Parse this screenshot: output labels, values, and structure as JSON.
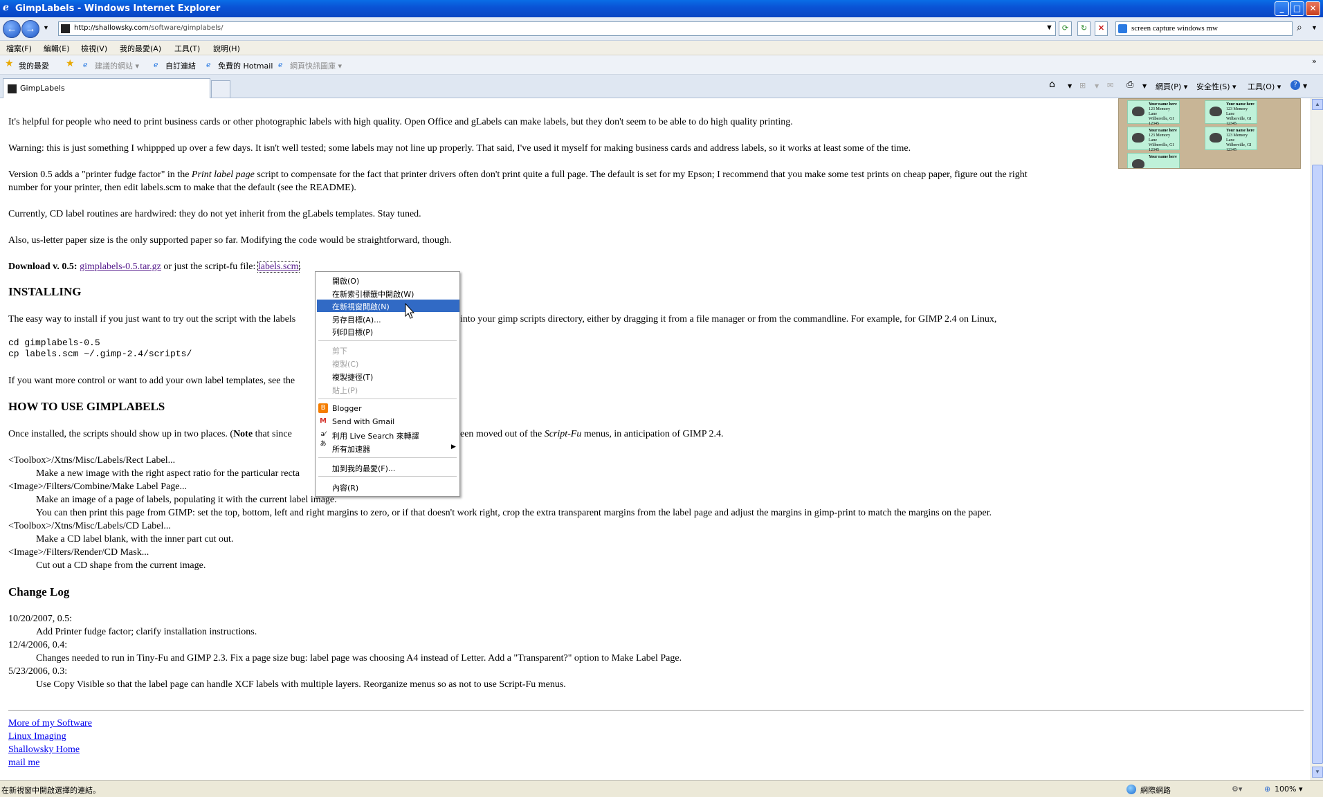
{
  "window": {
    "title": "GimpLabels - Windows Internet Explorer",
    "controls": {
      "minimize": "_",
      "maximize": "□",
      "close": "✕"
    }
  },
  "addressbar": {
    "url_domain": "http://shallowsky.com",
    "url_path": "/software/gimplabels/",
    "search_value": "screen capture windows mw"
  },
  "menubar": [
    "檔案(F)",
    "編輯(E)",
    "檢視(V)",
    "我的最愛(A)",
    "工具(T)",
    "說明(H)"
  ],
  "favbar": {
    "favorites": "我的最愛",
    "suggested": "建議的網站 ▾",
    "custom_links": "自訂連結",
    "hotmail": "免費的 Hotmail",
    "webslice": "網頁快訊圖庫 ▾",
    "more": "»"
  },
  "tabs": [
    {
      "label": "GimpLabels"
    }
  ],
  "commandbar": {
    "page": "網頁(P) ▾",
    "safety": "安全性(S) ▾",
    "tools": "工具(O) ▾"
  },
  "content": {
    "p1": "It's helpful for people who need to print business cards or other photographic labels with high quality. Open Office and gLabels can make labels, but they don't seem to be able to do high quality printing.",
    "p2": "Warning: this is just something I whippped up over a few days. It isn't well tested; some labels may not line up properly. That said, I've used it myself for making business cards and address labels, so it works at least some of the time.",
    "p3_a": "Version 0.5 adds a \"printer fudge factor\" in the ",
    "p3_em": "Print label page",
    "p3_b": " script to compensate for the fact that printer drivers often don't print quite a full page. The default is set for my Epson; I recommend that you make some test prints on cheap paper, figure out the right",
    "p3_c": "number for your printer, then edit labels.scm to make that the default (see the README).",
    "p4": "Currently, CD label routines are hardwired: they do not yet inherit from the gLabels templates. Stay tuned.",
    "p5": "Also, us-letter paper size is the only supported paper so far. Modifying the code would be straightforward, though.",
    "download_label": "Download v. 0.5:",
    "download_link1": "gimplabels-0.5.tar.gz",
    "download_mid": " or just the script-fu file: ",
    "download_link2": "labels.scm",
    "download_end": ".",
    "h_install": "INSTALLING",
    "install_a": "The easy way to install if you just want to try out the script with the labels ",
    "install_b": "into your gimp scripts directory, either by dragging it from a file manager or from the commandline. For example, for GIMP 2.4 on Linux,",
    "code": "cd gimplabels-0.5\ncp labels.scm ~/.gimp-2.4/scripts/",
    "more_control": "If you want more control or want to add your own label templates, see the",
    "h_howto": "HOW TO USE GIMPLABELS",
    "howto_a": "Once installed, the scripts should show up in two places. (",
    "howto_note": "Note",
    "howto_b": " that since",
    "howto_c": "een moved out of the ",
    "howto_em": "Script-Fu",
    "howto_d": " menus, in anticipation of GIMP 2.4.",
    "dl": [
      {
        "term": "<Toolbox>/Xtns/Misc/Labels/Rect Label...",
        "desc": [
          "Make a new image with the right aspect ratio for the particular recta"
        ]
      },
      {
        "term": "<Image>/Filters/Combine/Make Label Page...",
        "desc": [
          "Make an image of a page of labels, populating it with the current label image.",
          "You can then print this page from GIMP: set the top, bottom, left and right margins to zero, or if that doesn't work right, crop the extra transparent margins from the label page and adjust the margins in gimp-print to match the margins on the paper."
        ]
      },
      {
        "term": "<Toolbox>/Xtns/Misc/Labels/CD Label...",
        "desc": [
          "Make a CD label blank, with the inner part cut out."
        ]
      },
      {
        "term": "<Image>/Filters/Render/CD Mask...",
        "desc": [
          "Cut out a CD shape from the current image."
        ]
      }
    ],
    "h_changelog": "Change Log",
    "changelog": [
      {
        "ver": "10/20/2007, 0.5:",
        "desc": "Add Printer fudge factor; clarify installation instructions."
      },
      {
        "ver": "12/4/2006, 0.4:",
        "desc": "Changes needed to run in Tiny-Fu and GIMP 2.3. Fix a page size bug: label page was choosing A4 instead of Letter. Add a \"Transparent?\" option to Make Label Page."
      },
      {
        "ver": "5/23/2006, 0.3:",
        "desc": "Use Copy Visible so that the label page can handle XCF labels with multiple layers. Reorganize menus so as not to use Script-Fu menus."
      }
    ],
    "footer_links": [
      "More of my Software",
      "Linux Imaging",
      "Shallowsky Home",
      "mail me"
    ],
    "label_image_text": "Your name here",
    "label_image_line2": "123 Memory Lane",
    "label_image_line3": "Wilberville, GI 12345"
  },
  "context_menu": {
    "items": [
      "開啟(O)",
      "在新索引標籤中開啟(W)",
      "在新視窗開啟(N)",
      "另存目標(A)...",
      "列印目標(P)",
      "剪下",
      "複製(C)",
      "複製捷徑(T)",
      "貼上(P)",
      "Blogger",
      "Send with Gmail",
      "利用 Live Search 來轉譯",
      "所有加速器",
      "加到我的最愛(F)...",
      "內容(R)"
    ],
    "selected_index": 2,
    "disabled": [
      "剪下",
      "複製(C)",
      "貼上(P)"
    ]
  },
  "statusbar": {
    "text": "在新視窗中開啟選擇的連結。",
    "zone": "網際網路",
    "zoom": "100% ▾"
  }
}
